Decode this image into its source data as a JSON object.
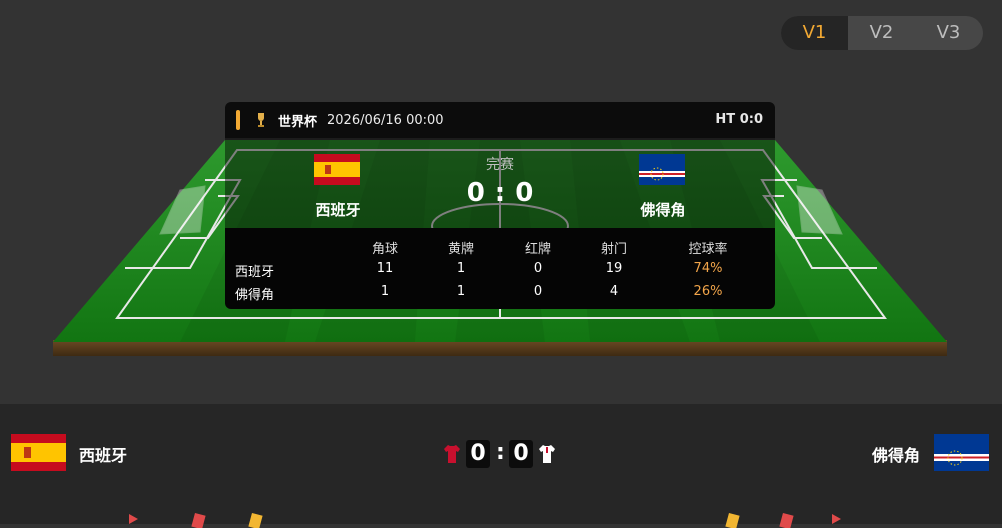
{
  "versions": {
    "items": [
      "V1",
      "V2",
      "V3"
    ],
    "active": "V1"
  },
  "match": {
    "league": "世界杯",
    "datetime": "2026/06/16 00:00",
    "halftime": "HT 0:0",
    "status": "完赛",
    "home": {
      "name": "西班牙",
      "score": "0"
    },
    "away": {
      "name": "佛得角",
      "score": "0"
    },
    "colon": ":"
  },
  "stats": {
    "headers": [
      "角球",
      "黄牌",
      "红牌",
      "射门",
      "控球率"
    ],
    "home": {
      "name": "西班牙",
      "values": [
        "11",
        "1",
        "0",
        "19",
        "74%"
      ]
    },
    "away": {
      "name": "佛得角",
      "values": [
        "1",
        "1",
        "0",
        "4",
        "26%"
      ]
    }
  },
  "colors": {
    "accent": "#f2a933",
    "pitch_green": "#1a7a1a",
    "possession": "#f2a54a",
    "home_shirt": "#c8102e",
    "away_shirt": "#ffffff"
  },
  "icons": [
    "trophy-icon",
    "spain-flag-icon",
    "cape-verde-flag-icon",
    "home-shirt-icon",
    "away-shirt-icon"
  ]
}
